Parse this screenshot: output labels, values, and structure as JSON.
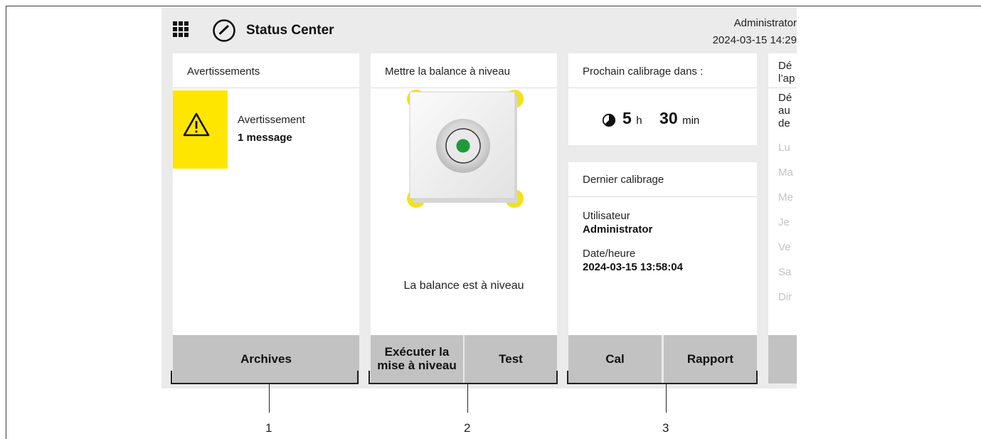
{
  "header": {
    "app_title": "Status Center",
    "user": "Administrator",
    "datetime": "2024-03-15 14:29",
    "icons": [
      "apps-grid-icon",
      "gauge-icon"
    ]
  },
  "warnings": {
    "title": "Avertissements",
    "item_label": "Avertissement",
    "item_count": "1 message",
    "button": "Archives",
    "tile_color": "#ffe600"
  },
  "leveling": {
    "title": "Mettre la balance à niveau",
    "status": "La balance est à niveau",
    "button_run_1": "Exécuter la",
    "button_run_2": "mise à niveau",
    "button_test": "Test",
    "bubble_color": "#1e9a3a",
    "foot_color": "#f2e21a"
  },
  "calibration": {
    "next_title": "Prochain calibrage dans :",
    "hours_value": "5",
    "hours_unit": "h",
    "minutes_value": "30",
    "minutes_unit": "min",
    "last_title": "Dernier calibrage",
    "user_label": "Utilisateur",
    "user_value": "Administrator",
    "date_label": "Date/heure",
    "date_value": "2024-03-15 13:58:04",
    "button_cal": "Cal",
    "button_report": "Rapport"
  },
  "fourth_panel": {
    "title_1": "Dé",
    "title_2": "l’ap",
    "text_1": "Dé",
    "text_2": "au",
    "text_3": "de",
    "days": [
      "Lu",
      "Ma",
      "Me",
      "Je",
      "Ve",
      "Sa",
      "Dir"
    ]
  },
  "callouts": [
    "1",
    "2",
    "3"
  ]
}
